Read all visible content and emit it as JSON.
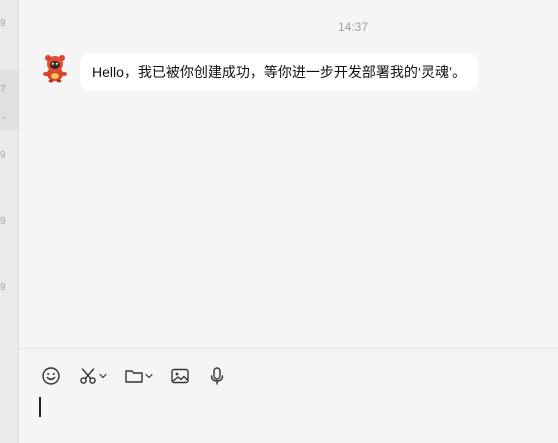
{
  "sidebar_fragments": [
    "9",
    "7",
    "9",
    "9",
    "9"
  ],
  "chat": {
    "timestamp": "14:37",
    "messages": [
      {
        "sender_avatar": "red-mascot-avatar",
        "text": "Hello，我已被你创建成功，等你进一步开发部署我的‘灵魂’。"
      }
    ]
  },
  "toolbar": {
    "icons": [
      "emoji-icon",
      "scissors-icon",
      "folder-icon",
      "image-icon",
      "microphone-icon"
    ]
  },
  "input": {
    "value": ""
  },
  "colors": {
    "background": "#f5f5f5",
    "bubble": "#ffffff",
    "text": "#111111",
    "timestamp": "#a0a0a0",
    "icon": "#333333"
  }
}
